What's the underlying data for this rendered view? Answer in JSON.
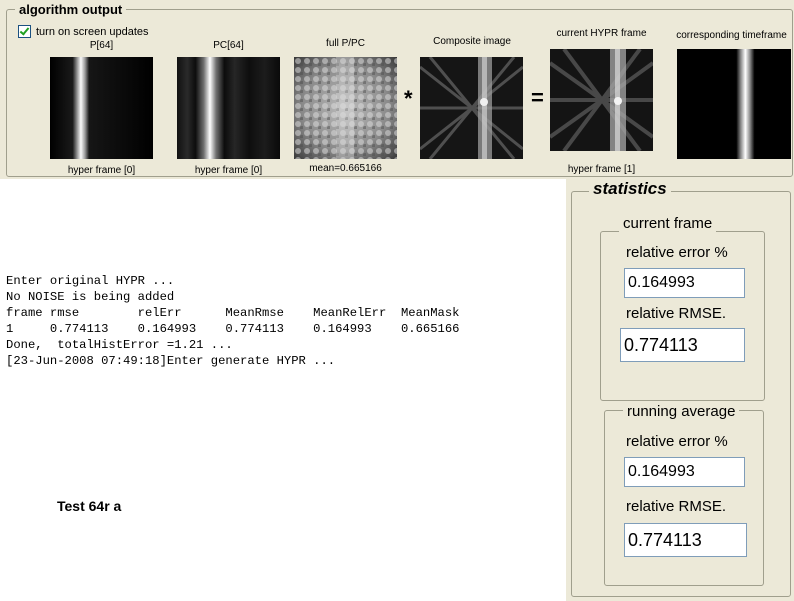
{
  "algorithm_output": {
    "title": "algorithm output",
    "updates_checkbox": {
      "label": "turn on screen updates",
      "checked": true
    },
    "images": [
      {
        "id": "p",
        "title": "P[64]",
        "caption": "hyper frame [0]"
      },
      {
        "id": "pc",
        "title": "PC[64]",
        "caption": "hyper frame [0]"
      },
      {
        "id": "full",
        "title": "full P/PC",
        "caption": "mean=0.665166"
      },
      {
        "id": "composite",
        "title": "Composite image",
        "caption": ""
      },
      {
        "id": "hypr",
        "title": "current HYPR frame",
        "caption": "hyper frame [1]"
      },
      {
        "id": "timeframe",
        "title": "corresponding timeframe",
        "caption": ""
      }
    ],
    "operators": {
      "multiply": "*",
      "equals": "="
    }
  },
  "console": {
    "lines": [
      "Enter original HYPR ...",
      "No NOISE is being added",
      "frame rmse        relErr      MeanRmse    MeanRelErr  MeanMask",
      "1     0.774113    0.164993    0.774113    0.164993    0.665166",
      "Done,  totalHistError =1.21 ...",
      "[23-Jun-2008 07:49:18]Enter generate HYPR ..."
    ]
  },
  "caption": "Test 64r a",
  "statistics": {
    "title": "statistics",
    "current_frame": {
      "title": "current frame",
      "relative_error_label": "relative error %",
      "relative_error_value": "0.164993",
      "relative_rmse_label": "relative RMSE.",
      "relative_rmse_value": "0.774113"
    },
    "running_average": {
      "title": "running average",
      "relative_error_label": "relative error %",
      "relative_error_value": "0.164993",
      "relative_rmse_label": "relative RMSE.",
      "relative_rmse_value": "0.774113"
    }
  }
}
